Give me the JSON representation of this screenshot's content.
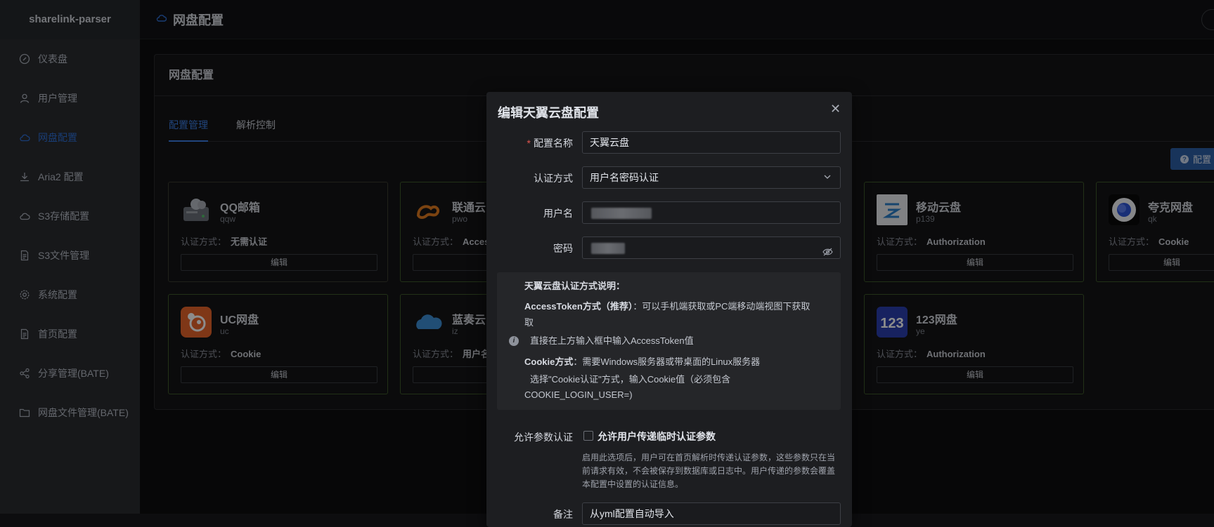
{
  "app": {
    "brand": "sharelink-parser",
    "page_title": "网盘配置"
  },
  "sidebar": {
    "items": [
      {
        "label": "仪表盘",
        "icon": "dashboard-icon"
      },
      {
        "label": "用户管理",
        "icon": "user-icon"
      },
      {
        "label": "网盘配置",
        "icon": "cloud-icon",
        "active": true
      },
      {
        "label": "Aria2 配置",
        "icon": "download-icon"
      },
      {
        "label": "S3存储配置",
        "icon": "cloud-icon"
      },
      {
        "label": "S3文件管理",
        "icon": "document-icon"
      },
      {
        "label": "系统配置",
        "icon": "gear-icon"
      },
      {
        "label": "首页配置",
        "icon": "document-icon"
      },
      {
        "label": "分享管理(BATE)",
        "icon": "share-icon"
      },
      {
        "label": "网盘文件管理(BATE)",
        "icon": "folder-icon"
      }
    ]
  },
  "panel": {
    "title": "网盘配置",
    "tabs": [
      "配置管理",
      "解析控制"
    ],
    "config_button": "配置",
    "auth_prefix": "认证方式：",
    "edit_label": "编辑",
    "cards": [
      {
        "name": "QQ邮箱",
        "code": "qqw",
        "auth": "无需认证"
      },
      {
        "name": "联通云",
        "code": "pwo",
        "auth": "Acces"
      },
      {
        "name": "移动云盘",
        "code": "p139",
        "auth": "Authorization"
      },
      {
        "name": "夸克网盘",
        "code": "qk",
        "auth": "Cookie"
      },
      {
        "name": "UC网盘",
        "code": "uc",
        "auth": "Cookie"
      },
      {
        "name": "蓝奏云",
        "code": "iz",
        "auth": "用户名"
      },
      {
        "name": "123网盘",
        "code": "ye",
        "auth": "Authorization"
      }
    ]
  },
  "modal": {
    "title": "编辑天翼云盘配置",
    "fields": {
      "config_name_label": "配置名称",
      "config_name_value": "天翼云盘",
      "auth_method_label": "认证方式",
      "auth_method_value": "用户名密码认证",
      "username_label": "用户名",
      "password_label": "密码",
      "note_label": "备注",
      "note_value": "从yml配置自动导入"
    },
    "info": {
      "heading": "天翼云盘认证方式说明：",
      "token_title": "AccessToken方式（推荐）",
      "token_desc": "：可以手机端获取或PC端移动端视图下获取",
      "token_desc_cont": "取",
      "token_step": "直接在上方输入框中输入AccessToken值",
      "cookie_title": "Cookie方式",
      "cookie_desc": "：需要Windows服务器或带桌面的Linux服务器",
      "cookie_step": "选择\"Cookie认证\"方式，输入Cookie值（必须包含",
      "cookie_step_cont": "COOKIE_LOGIN_USER=)"
    },
    "allow_param_label": "允许参数认证",
    "allow_param_checkbox": "允许用户传递临时认证参数",
    "allow_param_hint": "启用此选项后，用户可在首页解析时传递认证参数，这些参数只在当前请求有效，不会被保存到数据库或日志中。用户传递的参数会覆盖本配置中设置的认证信息。"
  }
}
